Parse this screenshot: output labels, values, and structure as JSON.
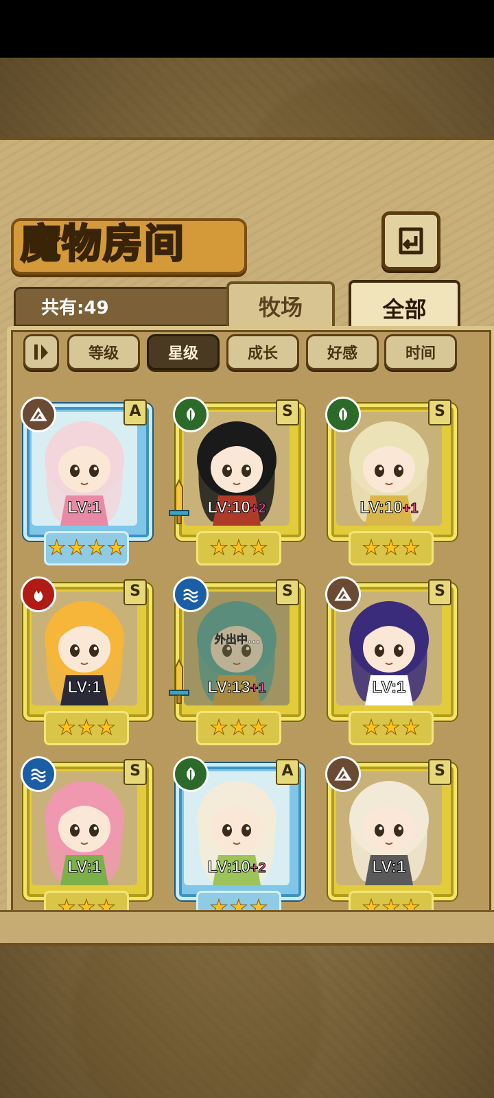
{
  "screen": {
    "title": "魔物房间",
    "count_label": "共有:49",
    "tabs": [
      {
        "label": "牧场",
        "selected": false
      },
      {
        "label": "全部",
        "selected": true
      }
    ],
    "filters": [
      {
        "label": "等级",
        "active": false
      },
      {
        "label": "星级",
        "active": true
      },
      {
        "label": "成长",
        "active": false
      },
      {
        "label": "好感",
        "active": false
      },
      {
        "label": "时间",
        "active": false
      }
    ],
    "icons": {
      "back": "return-arrow-icon",
      "sort": "sort-order-icon"
    }
  },
  "monsters": [
    {
      "element": "earth",
      "rank": "A",
      "level": "LV:1",
      "bonus": "",
      "stars": 4,
      "frame": "blue",
      "equipped": false,
      "away": false,
      "hair": "#f2d6dc",
      "accent": "#e88aa6"
    },
    {
      "element": "grass",
      "rank": "S",
      "level": "LV:10",
      "bonus": "+2",
      "stars": 3,
      "frame": "gold",
      "equipped": true,
      "away": false,
      "hair": "#1a1a1a",
      "accent": "#b03a2a"
    },
    {
      "element": "grass",
      "rank": "S",
      "level": "LV:10",
      "bonus": "+1",
      "stars": 3,
      "frame": "gold",
      "equipped": false,
      "away": false,
      "hair": "#ece2b8",
      "accent": "#d8b64a"
    },
    {
      "element": "fire",
      "rank": "S",
      "level": "LV:1",
      "bonus": "",
      "stars": 3,
      "frame": "gold",
      "equipped": false,
      "away": false,
      "hair": "#f6b63a",
      "accent": "#2a2a38"
    },
    {
      "element": "water",
      "rank": "S",
      "level": "LV:13",
      "bonus": "+1",
      "stars": 3,
      "frame": "gold",
      "equipped": true,
      "away": true,
      "away_label": "外出中...",
      "hair": "#4aa6a6",
      "accent": "#d8a040"
    },
    {
      "element": "earth",
      "rank": "S",
      "level": "LV:1",
      "bonus": "",
      "stars": 3,
      "frame": "gold",
      "equipped": false,
      "away": false,
      "hair": "#3a2c7a",
      "accent": "#ffffff"
    },
    {
      "element": "water",
      "rank": "S",
      "level": "LV:1",
      "bonus": "",
      "stars": 3,
      "frame": "gold",
      "equipped": false,
      "away": false,
      "hair": "#f098b0",
      "accent": "#7cb04a"
    },
    {
      "element": "grass",
      "rank": "A",
      "level": "LV:10",
      "bonus": "+2",
      "stars": 3,
      "frame": "blue",
      "equipped": false,
      "away": false,
      "hair": "#f4ecd8",
      "accent": "#9cc45a"
    },
    {
      "element": "earth",
      "rank": "S",
      "level": "LV:1",
      "bonus": "",
      "stars": 3,
      "frame": "gold",
      "equipped": false,
      "away": false,
      "hair": "#f2ead6",
      "accent": "#5a5a5a"
    }
  ]
}
